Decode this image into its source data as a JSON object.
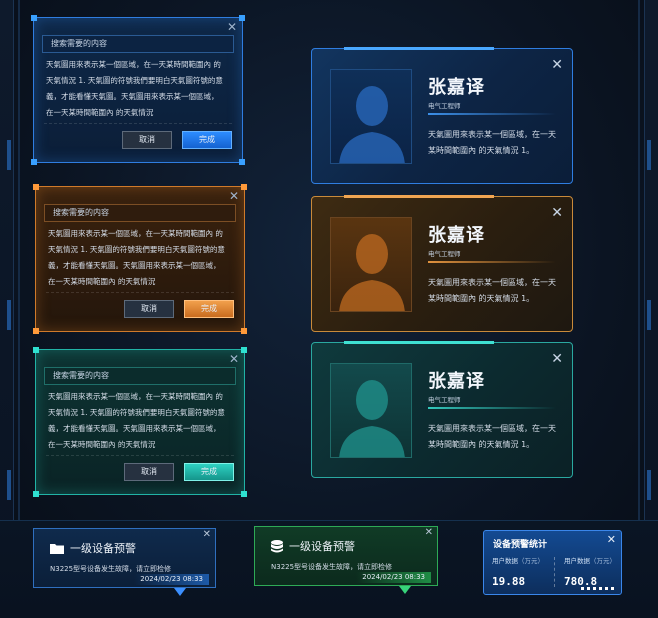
{
  "dialogs": [
    {
      "theme": "blue",
      "search_placeholder": "搜索需要的内容",
      "body_lines": [
        "天氣圖用來表示某一個區域，在一天某時間範圍內 的",
        "天氣情況 1. 天氣圖的符號我們要明白天氣圖符號的意",
        "義，才能看懂天氣圖。天氣圖用來表示某一個區域，",
        "在一天某時間範圍內 的天氣情況"
      ],
      "cancel_label": "取消",
      "ok_label": "完成"
    },
    {
      "theme": "orange",
      "search_placeholder": "搜索需要的内容",
      "body_lines": [
        "天氣圖用來表示某一個區域，在一天某時間範圍內 的",
        "天氣情況 1. 天氣圖的符號我們要明白天氣圖符號的意",
        "義，才能看懂天氣圖。天氣圖用來表示某一個區域，",
        "在一天某時間範圍內 的天氣情況"
      ],
      "cancel_label": "取消",
      "ok_label": "完成"
    },
    {
      "theme": "teal",
      "search_placeholder": "搜索需要的内容",
      "body_lines": [
        "天氣圖用來表示某一個區域，在一天某時間範圍內 的",
        "天氣情況 1. 天氣圖的符號我們要明白天氣圖符號的意",
        "義，才能看懂天氣圖。天氣圖用來表示某一個區域，",
        "在一天某時間範圍內 的天氣情況"
      ],
      "cancel_label": "取消",
      "ok_label": "完成"
    }
  ],
  "profiles": [
    {
      "theme": "blue",
      "name": "张嘉译",
      "role": "电气工程师",
      "desc": "天氣圖用來表示某一個區域，在一天某時間範圍內 的天氣情況 1。"
    },
    {
      "theme": "orange",
      "name": "张嘉译",
      "role": "电气工程师",
      "desc": "天氣圖用來表示某一個區域，在一天某時間範圍內 的天氣情況 1。"
    },
    {
      "theme": "teal",
      "name": "张嘉译",
      "role": "电气工程师",
      "desc": "天氣圖用來表示某一個區域，在一天某時間範圍內 的天氣情況 1。"
    }
  ],
  "alerts": [
    {
      "theme": "blue",
      "icon": "folder-icon",
      "title": "一级设备预警",
      "message": "N3225型号设备发生故障，请立即检修",
      "time": "2024/02/23 08:33"
    },
    {
      "theme": "green",
      "icon": "database-icon",
      "title": "一级设备预警",
      "message": "N3225型号设备发生故障，请立即检修",
      "time": "2024/02/23 08:33"
    }
  ],
  "stats": {
    "title": "设备预警统计",
    "left_label": "用户数据",
    "left_unit": "（万元）",
    "left_value": "19.88",
    "right_label": "用户数据",
    "right_unit": "（万元）",
    "right_value": "780.8"
  },
  "colors": {
    "blue": "#2f7de0",
    "orange": "#d07a2a",
    "teal": "#21b3a6",
    "green": "#2eaa56"
  },
  "close_glyph": "✕"
}
